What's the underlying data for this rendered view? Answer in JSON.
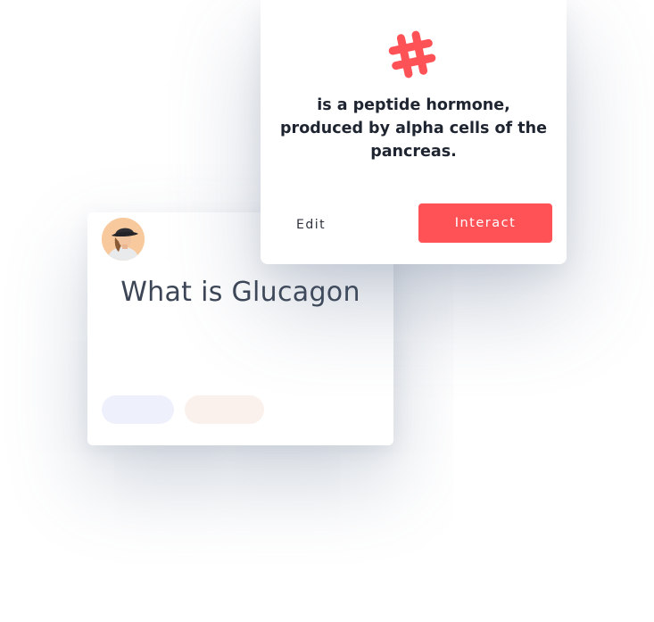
{
  "question_card": {
    "question": "What is Glucagon",
    "avatar_icon": "user-avatar-woman-in-hat",
    "colors": {
      "pill_blue": "#eef1fb",
      "pill_peach": "#fbf1ec",
      "text": "#3c4656"
    }
  },
  "answer_card": {
    "icon": "hashtag-icon",
    "answer": "is a peptide hormone, produced by alpha cells of the pancreas.",
    "edit_label": "Edit",
    "interact_label": "Interact",
    "colors": {
      "accent": "#ff5257",
      "text": "#1e2430"
    }
  }
}
